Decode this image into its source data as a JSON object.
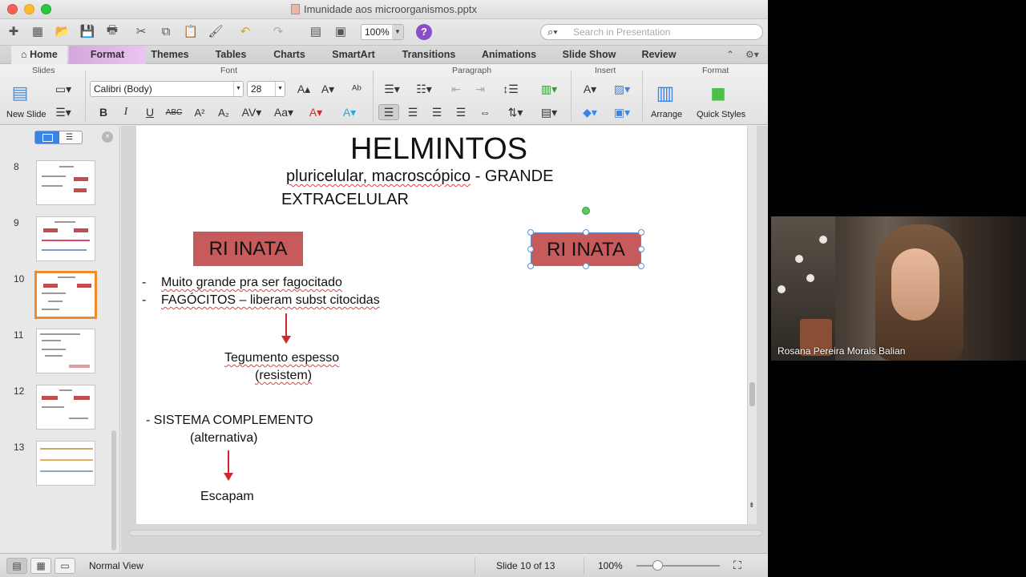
{
  "window": {
    "title": "Imunidade aos microorganismos.pptx"
  },
  "toolbar": {
    "zoom": "100%",
    "help": "?",
    "search_placeholder": "Search in Presentation"
  },
  "tabs": [
    "Home",
    "Format",
    "Themes",
    "Tables",
    "Charts",
    "SmartArt",
    "Transitions",
    "Animations",
    "Slide Show",
    "Review"
  ],
  "ribbon": {
    "groups": {
      "slides": "Slides",
      "font": "Font",
      "paragraph": "Paragraph",
      "insert": "Insert",
      "format": "Format"
    },
    "new_slide": "New Slide",
    "font_name": "Calibri (Body)",
    "font_size": "28",
    "bold": "B",
    "italic": "I",
    "underline": "U",
    "strike": "ABC",
    "superscript": "A²",
    "subscript": "A₂",
    "arrange": "Arrange",
    "quick_styles": "Quick Styles"
  },
  "thumbnails": [
    {
      "num": "8"
    },
    {
      "num": "9"
    },
    {
      "num": "10",
      "selected": true
    },
    {
      "num": "11"
    },
    {
      "num": "12"
    },
    {
      "num": "13"
    }
  ],
  "slide": {
    "title": "HELMINTOS",
    "subtitle_a": "pluricelular, macroscópico",
    "subtitle_b": " - GRANDE",
    "subtitle_c": "EXTRACELULAR",
    "box_left": "RI INATA",
    "box_right": "RI INATA",
    "bullet_dash": "-",
    "bullet1": "Muito grande pra ser fagocitado",
    "bullet2": "FAGÓCITOS – liberam subst citocidas",
    "tegumento_1": "Tegumento espesso",
    "tegumento_2": "(resistem)",
    "complemento_1": "- SISTEMA COMPLEMENTO",
    "complemento_2": "(alternativa)",
    "escapam": "Escapam"
  },
  "status": {
    "view": "Normal View",
    "slide": "Slide 10 of 13",
    "zoom": "100%"
  },
  "video": {
    "participant": "Rosana Pereira Morais Balian"
  },
  "colors": {
    "accent_box": "#c75a5a",
    "arrow": "#d0262e",
    "selection": "#f08c28",
    "format_tab": "#d6a6de"
  }
}
